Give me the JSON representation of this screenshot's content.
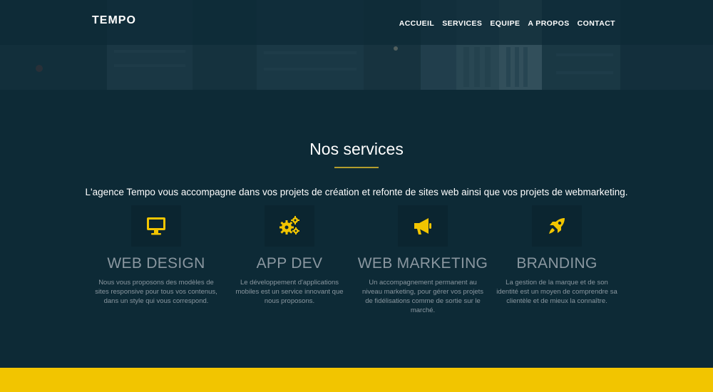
{
  "brand": {
    "name": "TEMPO"
  },
  "nav": {
    "items": [
      {
        "label": "ACCUEIL"
      },
      {
        "label": "SERVICES"
      },
      {
        "label": "EQUIPE"
      },
      {
        "label": "A PROPOS"
      },
      {
        "label": "CONTACT"
      }
    ]
  },
  "services_section": {
    "title": "Nos services",
    "intro": "L'agence Tempo vous accompagne dans vos projets de création et refonte de sites web ainsi que vos projets de webmarketing.",
    "items": [
      {
        "icon": "monitor-icon",
        "title": "WEB DESIGN",
        "description": "Nous vous proposons des modèles de sites responsive pour tous vos contenus, dans un style qui vous correspond."
      },
      {
        "icon": "gears-icon",
        "title": "APP DEV",
        "description": "Le développement d'applications mobiles est un service innovant que nous proposons."
      },
      {
        "icon": "megaphone-icon",
        "title": "WEB MARKETING",
        "description": "Un accompagnement permanent au niveau marketing, pour gérer vos projets de fidélisations comme de sortie sur le marché."
      },
      {
        "icon": "rocket-icon",
        "title": "BRANDING",
        "description": "La gestion de la marque et de son identité est un moyen de comprendre sa clientèle et de mieux la connaître."
      }
    ]
  },
  "colors": {
    "background": "#0d2a36",
    "accent": "#f2c500",
    "rule": "#b39d2e",
    "muted_text": "#8a97a0"
  }
}
